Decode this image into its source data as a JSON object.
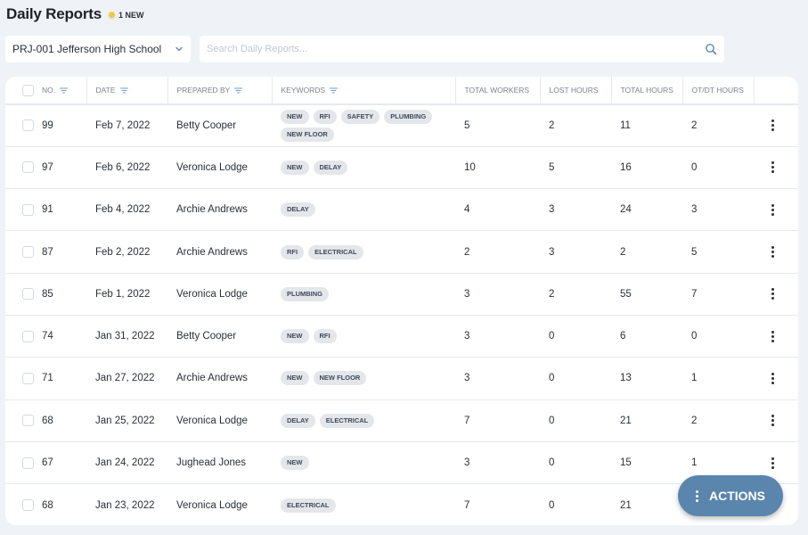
{
  "header": {
    "title": "Daily Reports",
    "new_badge": "1 NEW",
    "new_dot_color": "#f5c842"
  },
  "project_select": {
    "value": "PRJ-001 Jefferson High School"
  },
  "search": {
    "placeholder": "Search Daily Reports..."
  },
  "table": {
    "columns": [
      {
        "label": "No.",
        "filter": true
      },
      {
        "label": "Date",
        "filter": true
      },
      {
        "label": "Prepared By",
        "filter": true
      },
      {
        "label": "Keywords",
        "filter": true
      },
      {
        "label": "Total Workers",
        "filter": false
      },
      {
        "label": "Lost Hours",
        "filter": false
      },
      {
        "label": "Total Hours",
        "filter": false
      },
      {
        "label": "OT/DT Hours",
        "filter": false
      }
    ],
    "rows": [
      {
        "no": "99",
        "date": "Feb 7, 2022",
        "prepared_by": "Betty Cooper",
        "keywords": [
          "NEW",
          "RFI",
          "SAFETY",
          "PLUMBING",
          "NEW FLOOR"
        ],
        "total_workers": "5",
        "lost_hours": "2",
        "total_hours": "11",
        "ot_dt_hours": "2"
      },
      {
        "no": "97",
        "date": "Feb 6, 2022",
        "prepared_by": "Veronica Lodge",
        "keywords": [
          "NEW",
          "DELAY"
        ],
        "total_workers": "10",
        "lost_hours": "5",
        "total_hours": "16",
        "ot_dt_hours": "0"
      },
      {
        "no": "91",
        "date": "Feb 4, 2022",
        "prepared_by": "Archie Andrews",
        "keywords": [
          "DELAY"
        ],
        "total_workers": "4",
        "lost_hours": "3",
        "total_hours": "24",
        "ot_dt_hours": "3"
      },
      {
        "no": "87",
        "date": "Feb 2, 2022",
        "prepared_by": "Archie Andrews",
        "keywords": [
          "RFI",
          "ELECTRICAL"
        ],
        "total_workers": "2",
        "lost_hours": "3",
        "total_hours": "2",
        "ot_dt_hours": "5"
      },
      {
        "no": "85",
        "date": "Feb 1, 2022",
        "prepared_by": "Veronica Lodge",
        "keywords": [
          "PLUMBING"
        ],
        "total_workers": "3",
        "lost_hours": "2",
        "total_hours": "55",
        "ot_dt_hours": "7"
      },
      {
        "no": "74",
        "date": "Jan 31, 2022",
        "prepared_by": "Betty Cooper",
        "keywords": [
          "NEW",
          "RFI"
        ],
        "total_workers": "3",
        "lost_hours": "0",
        "total_hours": "6",
        "ot_dt_hours": "0"
      },
      {
        "no": "71",
        "date": "Jan 27, 2022",
        "prepared_by": "Archie Andrews",
        "keywords": [
          "NEW",
          "NEW FLOOR"
        ],
        "total_workers": "3",
        "lost_hours": "0",
        "total_hours": "13",
        "ot_dt_hours": "1"
      },
      {
        "no": "68",
        "date": "Jan 25, 2022",
        "prepared_by": "Veronica Lodge",
        "keywords": [
          "DELAY",
          "ELECTRICAL"
        ],
        "total_workers": "7",
        "lost_hours": "0",
        "total_hours": "21",
        "ot_dt_hours": "2"
      },
      {
        "no": "67",
        "date": "Jan 24, 2022",
        "prepared_by": "Jughead Jones",
        "keywords": [
          "NEW"
        ],
        "total_workers": "3",
        "lost_hours": "0",
        "total_hours": "15",
        "ot_dt_hours": "1"
      },
      {
        "no": "68",
        "date": "Jan 23, 2022",
        "prepared_by": "Veronica Lodge",
        "keywords": [
          "ELECTRICAL"
        ],
        "total_workers": "7",
        "lost_hours": "0",
        "total_hours": "21",
        "ot_dt_hours": ""
      }
    ]
  },
  "actions_button": {
    "label": "ACTIONS",
    "color": "#5a86ae"
  }
}
